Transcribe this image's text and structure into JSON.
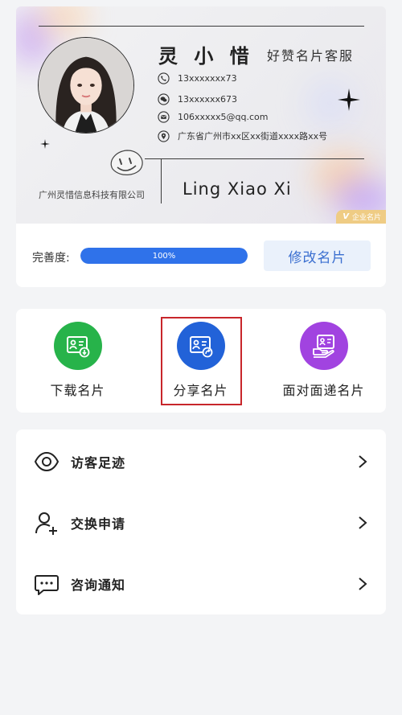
{
  "card": {
    "name": "灵 小 惜",
    "role": "好赞名片客服",
    "phone": "13xxxxxxx73",
    "wechat": "13xxxxxx673",
    "email": "106xxxxx5@qq.com",
    "address": "广东省广州市xx区xx街道xxxx路xx号",
    "company": "广州灵惜信息科技有限公司",
    "english_name": "Ling Xiao Xi",
    "badge": "企业名片",
    "badge_mark": "V"
  },
  "progress": {
    "label": "完善度:",
    "percent": 100,
    "percent_text": "100%",
    "edit_button": "修改名片"
  },
  "actions": [
    {
      "label": "下载名片",
      "color": "#27b34a",
      "icon": "card-download-icon"
    },
    {
      "label": "分享名片",
      "color": "#2262d8",
      "icon": "card-share-icon"
    },
    {
      "label": "面对面递名片",
      "color": "#a143e0",
      "icon": "card-hand-icon"
    }
  ],
  "menu": [
    {
      "label": "访客足迹",
      "icon": "eye-icon"
    },
    {
      "label": "交换申请",
      "icon": "add-user-icon"
    },
    {
      "label": "咨询通知",
      "icon": "message-icon"
    }
  ],
  "colors": {
    "accent_blue": "#2f72ea",
    "highlight_red": "#c8262b",
    "badge_gold": "#efcc84"
  }
}
